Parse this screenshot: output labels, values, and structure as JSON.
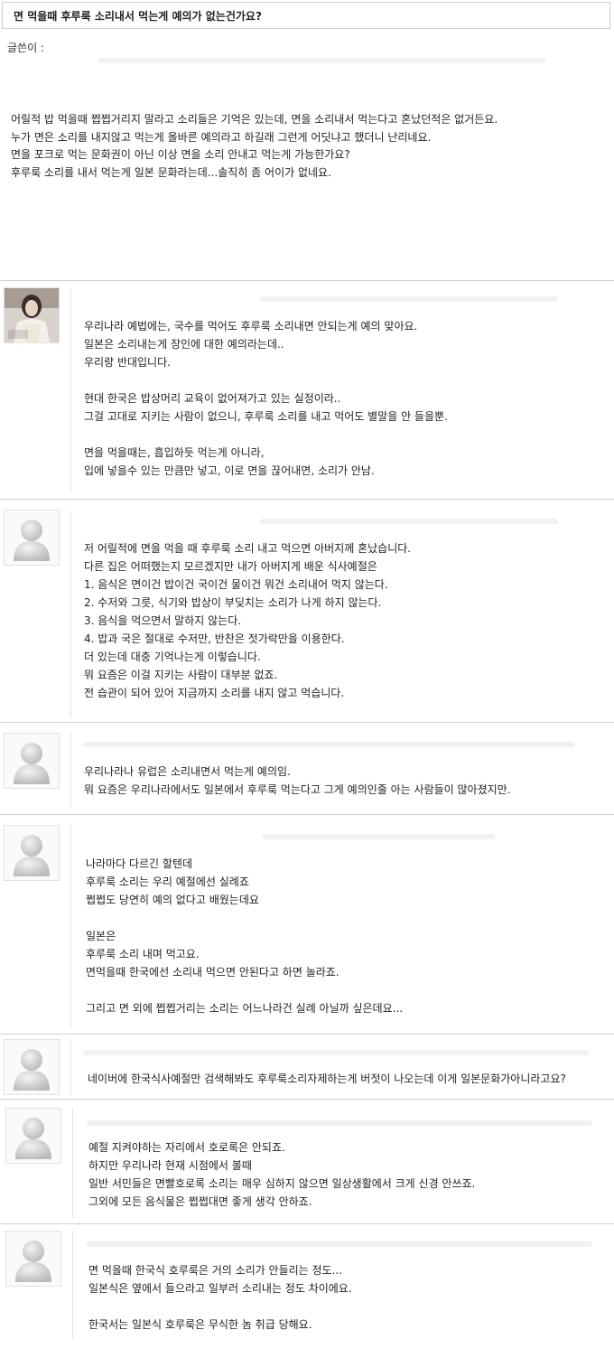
{
  "title": "면 먹을때 후루룩 소리내서 먹는게 예의가 없는건가요?",
  "author_label": "글쓴이 :",
  "post_body": [
    "어릴적 밥 먹을때 쩝쩝거리지 말라고 소리들은 기억은 있는데, 면을 소리내서 먹는다고 혼났던적은 없거든요.",
    "누가 면은 소리를 내지않고 먹는게 올바른 예의라고 하길래 그런게 어딧냐고 했더니 난리네요.",
    "면을 포크로 먹는 문화권이 아닌 이상 면을 소리 안내고 먹는게 가능한가요?",
    "후루룩 소리를 내서 먹는게 일본 문화라는데...솔직히 좀 어이가 없네요."
  ],
  "comments": [
    {
      "lines": [
        "우리나라 예법에는, 국수를 먹어도 후루룩 소리내면 안되는게 예의 맞아요.",
        "일본은 소리내는게 장인에 대한 예의라는데..",
        "우리랑 반대입니다.",
        "",
        "현대 한국은 밥상머리 교육이 없어져가고 있는 실정이라..",
        "그걸 고대로 지키는 사람이 없으니, 후루룩 소리를 내고 먹어도 별말을 안 들을뿐.",
        "",
        "면을 먹을때는, 흡입하듯 먹는게 아니라,",
        "입에 넣을수 있는 만큼만 넣고, 이로 면을 끊어내면, 소리가 안남."
      ]
    },
    {
      "lines": [
        "저 어릴적에 면을 먹을 때 후루룩 소리 내고 먹으면 아버지께 혼났습니다.",
        "다른 집은 어떠했는지 모르겠지만 내가 아버지게 배운 식사예절은",
        "1. 음식은 면이건 밥이건 국이건 물이건 뭐건 소리내어 먹지 않는다.",
        "2. 수저와 그릇, 식기와 밥상이 부딪치는 소리가 나게 하지 않는다.",
        "3. 음식을 먹으면서 말하지 않는다.",
        "4. 밥과 국은 절대로 수저만, 반찬은 젓가락만을 이용한다.",
        "더 있는데 대충 기억나는게 이렇습니다.",
        "뭐 요즘은 이걸 지키는 사람이 대부분 없죠.",
        "전 습관이 되어 있어 지금까지 소리를 내지 않고 먹습니다."
      ]
    },
    {
      "lines": [
        "우리나라나 유럽은 소리내면서 먹는게 예의임.",
        "뭐 요즘은 우리나라에서도 일본에서 후루룩 먹는다고 그게 예의인줄 아는 사람들이 많아졌지만."
      ]
    },
    {
      "lines": [
        "나라마다 다르긴 할텐데",
        "후루룩 소리는 우리 예절에선 실례죠",
        "쩝쩝도 당연히 예의 없다고 배웠는데요",
        "",
        "일본은",
        "후루룩 소리 내며 먹고요.",
        "면먹을때 한국에선 소리내 먹으면 안된다고 하면 놀라죠.",
        "",
        "그리고 면 외에 쩝쩝거리는 소리는 어느나라건 실례 아닐까 싶은데요..."
      ]
    },
    {
      "lines": [
        "네이버에 한국식사예절만 검색해봐도 후루룩소리자제하는게 버젓이 나오는데 이게 일본문화가아니라고요?"
      ]
    },
    {
      "lines": [
        "예절 지켜야하는 자리에서 호로록은 안되죠.",
        "하지만 우리나라 현재 시점에서 볼때",
        "일반 서민들은 면빨호로록 소리는 매우 심하지 않으면  일상생활에서 크게 신경 안쓰죠.",
        "그외에 모든 음식물은 쩝쩝대면 좋게 생각 안하죠."
      ]
    },
    {
      "lines": [
        "면 먹을때 한국식 호루룩은 거의 소리가 안들리는 정도...",
        "일본식은 옆에서 들으라고 일부러 소리내는 정도 차이에요.",
        "",
        "한국서는 일본식 호루룩은 무식한 놈 취급 당해요."
      ]
    }
  ]
}
